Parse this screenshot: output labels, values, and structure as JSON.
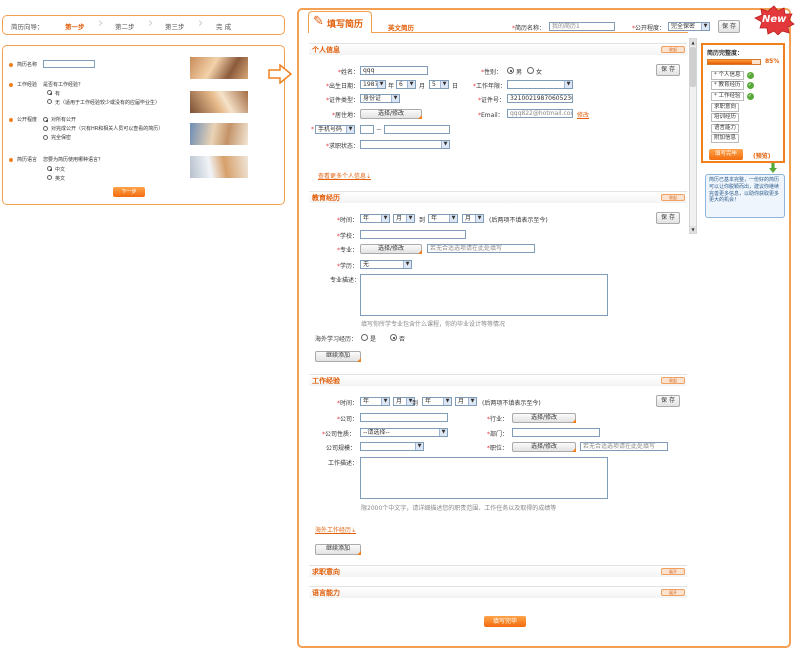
{
  "wizard": {
    "label": "简历向导：",
    "steps": [
      "第一步",
      "第二步",
      "第三步",
      "完 成"
    ],
    "resume_name_label": "简历名称",
    "work_exp_label": "工作经验",
    "work_exp_question": "是否有工作经验？",
    "work_exp_yes": "有",
    "work_exp_no": "无（适用于工作经验较少或没有的应届毕业生）",
    "public_label": "公开程度",
    "public_opt1": "对所有公开",
    "public_opt2": "对完成公开（只有HR和相关人员可以查看的简历）",
    "public_opt3": "完全保密",
    "lang_label": "简历语言",
    "lang_question": "您要为简历使用哪种语言？",
    "lang_cn": "中文",
    "lang_en": "英文",
    "next_button": "下一步"
  },
  "header": {
    "title": "填写简历",
    "english_tab": "英文简历",
    "resume_name_label": "简历名称：",
    "resume_name_placeholder": "我的简历1",
    "public_label": "公开程度：",
    "public_value": "完全保密",
    "save_label": "保 存",
    "new_badge": "New"
  },
  "personal": {
    "section_title": "个人信息",
    "collapse_label": "收起",
    "name_label": "姓名：",
    "name_value": "qqq",
    "gender_label": "性别：",
    "male": "男",
    "female": "女",
    "birth_label": "出生日期：",
    "birth_year": "1987",
    "birth_month": "6",
    "birth_day": "5",
    "year_unit": "年",
    "month_unit": "月",
    "day_unit": "日",
    "work_years_label": "工作年限：",
    "id_type_label": "证件类型：",
    "id_type_value": "身份证",
    "id_number_label": "证件号：",
    "id_number_value": "321002198706052360",
    "residence_label": "居住地：",
    "residence_button": "选择/修改",
    "email_label": "Email：",
    "email_value": "qqq822@hotmail.com",
    "email_modify": "修改",
    "phone_type": "手机号码",
    "phone_dash": "－",
    "job_status_label": "求职状态：",
    "more_link": "查看更多个人信息",
    "save_label": "保 存"
  },
  "education": {
    "section_title": "教育经历",
    "collapse_label": "收起",
    "time_label": "时间：",
    "year_ph": "年",
    "month_ph": "月",
    "to": "到",
    "time_hint": "(后两项不填表示至今)",
    "school_label": "学校：",
    "major_label": "专业：",
    "major_button": "选择/修改",
    "major_hint": "若无合适选项请在此处填写",
    "degree_label": "学历：",
    "degree_value": "无",
    "desc_label": "专业描述：",
    "desc_hint": "填写你所学专业包含什么课程，你的毕业设计等等情况",
    "overseas_label": "海外学习经历：",
    "overseas_yes": "是",
    "overseas_no": "否",
    "add_more": "继续添加",
    "save_label": "保 存"
  },
  "work": {
    "section_title": "工作经验",
    "collapse_label": "收起",
    "time_label": "时间：",
    "year_ph": "年",
    "month_ph": "月",
    "to": "到",
    "time_hint": "(后两项不填表示至今)",
    "company_label": "公司：",
    "industry_label": "行业：",
    "industry_button": "选择/修改",
    "company_type_label": "公司性质：",
    "company_type_value": "--请选择--",
    "department_label": "部门：",
    "company_size_label": "公司规模：",
    "position_label": "职位：",
    "position_button": "选择/修改",
    "position_hint": "若无合适选项请在此处填写",
    "desc_label": "工作描述：",
    "desc_hint": "限2000个中文字，请详细描述您的职责范围、工作任务以及取得的成绩等",
    "overseas_link": "海外工作经历",
    "add_more": "继续添加",
    "save_label": "保 存"
  },
  "intent": {
    "section_title": "求职意向",
    "expand_label": "展开"
  },
  "language": {
    "section_title": "语言能力",
    "expand_label": "展开"
  },
  "footer": {
    "finish_button": "填写完毕"
  },
  "sidebar": {
    "completeness_label": "简历完整度：",
    "percent": 85,
    "percent_text": "85%",
    "items": [
      "个人信息",
      "教育经历",
      "工作经验",
      "求职意向",
      "培训经历",
      "语言能力",
      "附加信息"
    ],
    "finish_button": "填写完毕",
    "preview_link": "(预览)",
    "tip": "简历已基本完整，一份好的简历可以让你脱颖而出，建议你继续完善更多信息，以助你获取更多更大的机会！"
  },
  "colors": {
    "accent": "#f26d0e",
    "border": "#f4a052",
    "section_title": "#e25d08",
    "new_badge": "#e4393c"
  }
}
